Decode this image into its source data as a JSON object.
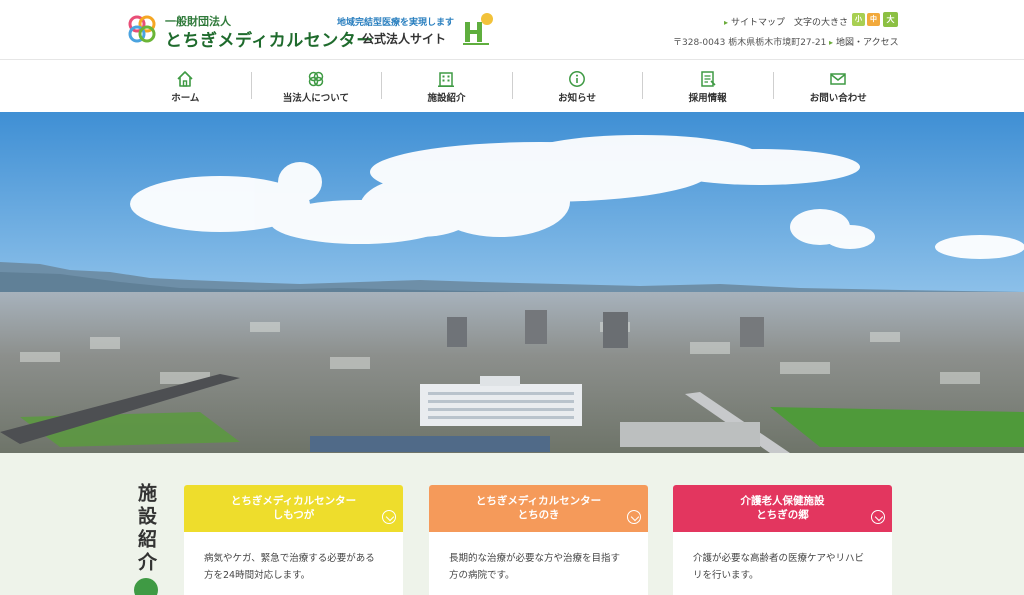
{
  "header": {
    "org_type": "一般財団法人",
    "org_name": "とちぎメディカルセンター",
    "org_sub": "公式法人サイト",
    "tagline": "地域完結型医療を実現します",
    "sitemap": "サイトマップ",
    "text_size_label": "文字の大きさ",
    "text_sizes": [
      "小",
      "中",
      "大"
    ],
    "address": "〒328-0043 栃木県栃木市境町27-21",
    "map_link": "地図・アクセス"
  },
  "nav": {
    "items": [
      {
        "label": "ホーム",
        "icon": "home-icon"
      },
      {
        "label": "当法人について",
        "icon": "logo-icon"
      },
      {
        "label": "施設紹介",
        "icon": "building-icon"
      },
      {
        "label": "お知らせ",
        "icon": "info-icon"
      },
      {
        "label": "採用情報",
        "icon": "document-icon"
      },
      {
        "label": "お問い合わせ",
        "icon": "mail-icon"
      }
    ]
  },
  "facilities": {
    "title": "施設紹介",
    "cards": [
      {
        "title_line1": "とちぎメディカルセンター",
        "title_line2": "しもつが",
        "description": "病気やケガ、緊急で治療する必要がある方を24時間対応します。",
        "color": "#eedd2c"
      },
      {
        "title_line1": "とちぎメディカルセンター",
        "title_line2": "とちのき",
        "description": "長期的な治療が必要な方や治療を目指す方の病院です。",
        "color": "#f59a5a"
      },
      {
        "title_line1": "介護老人保健施設",
        "title_line2": "とちぎの郷",
        "description": "介護が必要な高齢者の医療ケアやリハビリを行います。",
        "color": "#e3365f"
      }
    ]
  },
  "colors": {
    "brand_green": "#1f6b2d",
    "accent_blue": "#2a7fbf"
  }
}
